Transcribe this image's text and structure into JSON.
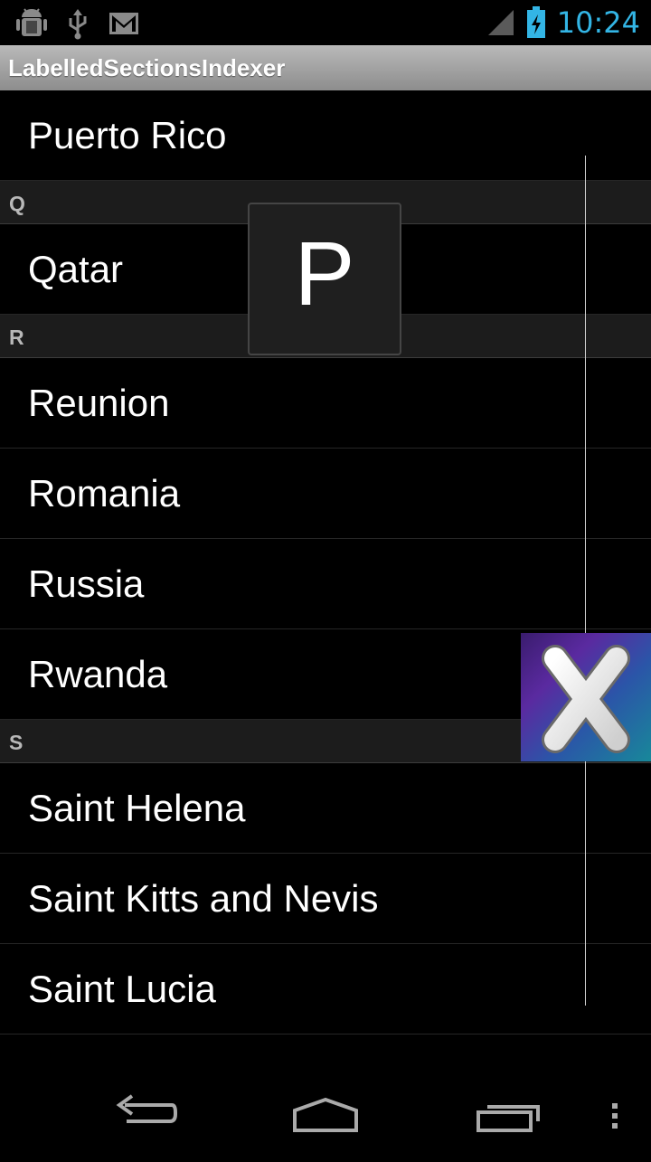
{
  "status_bar": {
    "time": "10:24",
    "notification_icons": [
      "android-debug-icon",
      "usb-icon",
      "gmail-icon"
    ],
    "accent_color": "#33b5e5"
  },
  "app": {
    "title": "LabelledSectionsIndexer"
  },
  "list": {
    "rows": [
      {
        "type": "item",
        "label": "Puerto Rico"
      },
      {
        "type": "header",
        "label": "Q"
      },
      {
        "type": "item",
        "label": "Qatar"
      },
      {
        "type": "header",
        "label": "R"
      },
      {
        "type": "item",
        "label": "Reunion"
      },
      {
        "type": "item",
        "label": "Romania"
      },
      {
        "type": "item",
        "label": "Russia"
      },
      {
        "type": "item",
        "label": "Rwanda"
      },
      {
        "type": "header",
        "label": "S"
      },
      {
        "type": "item",
        "label": "Saint Helena"
      },
      {
        "type": "item",
        "label": "Saint Kitts and Nevis"
      },
      {
        "type": "item",
        "label": "Saint Lucia"
      }
    ]
  },
  "fast_scroll": {
    "overlay_letter": "P"
  },
  "nav_bar": {
    "buttons": [
      "back-icon",
      "home-icon",
      "recent-apps-icon",
      "menu-icon"
    ]
  }
}
